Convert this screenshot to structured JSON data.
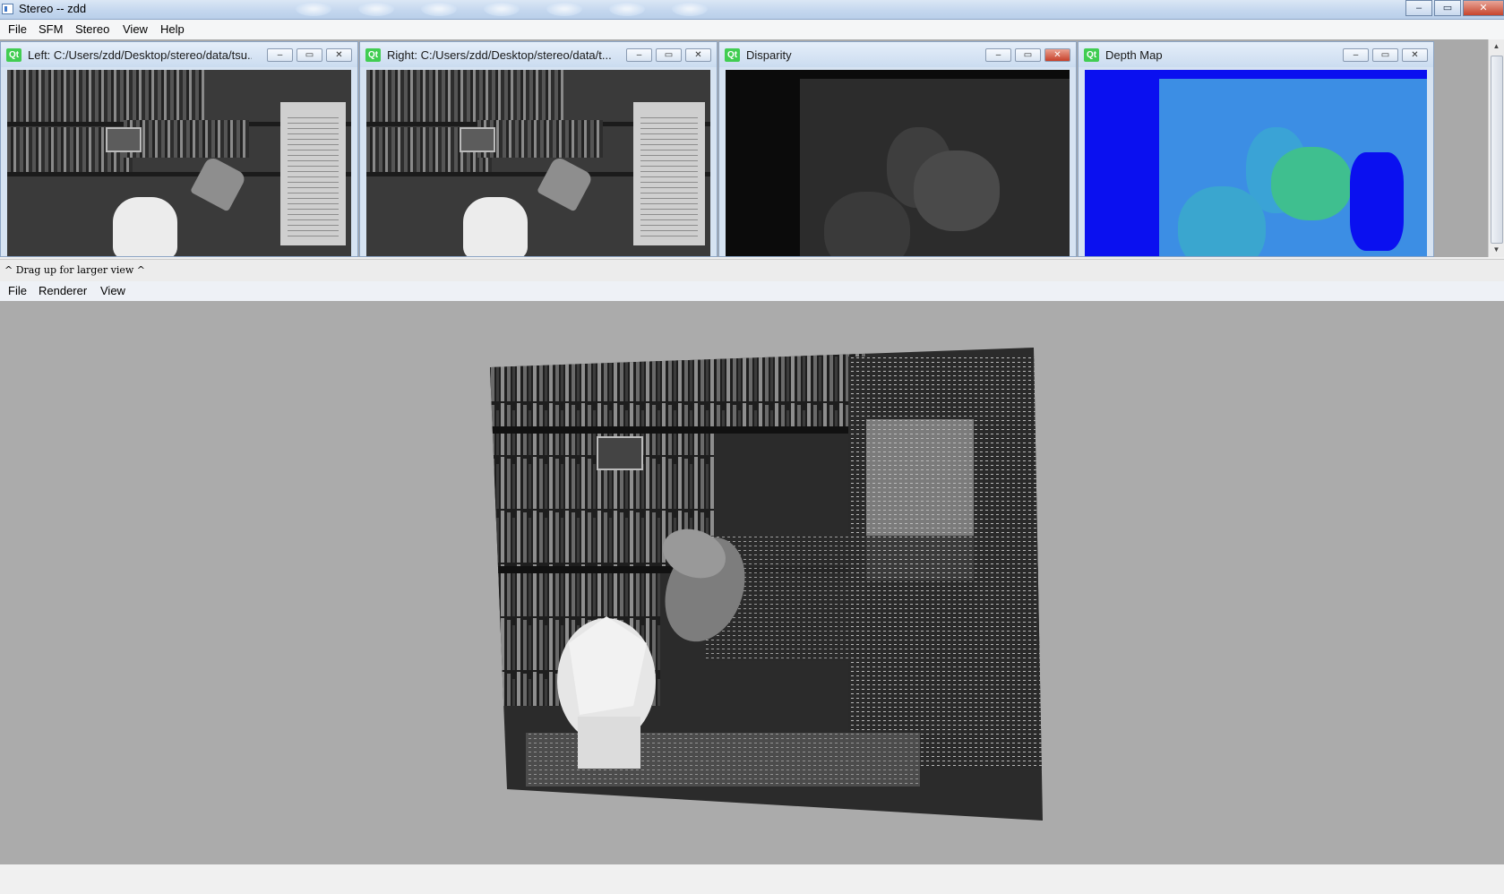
{
  "window": {
    "title": "Stereo -- zdd",
    "controls": {
      "minimize": "–",
      "maximize": "▭",
      "close": "✕"
    }
  },
  "menubar_top": {
    "items": [
      "File",
      "SFM",
      "Stereo",
      "View",
      "Help"
    ]
  },
  "subwindows": [
    {
      "title": "Left: C:/Users/zdd/Desktop/stereo/data/tsu...",
      "logo": "Qt",
      "btns": [
        "–",
        "▭",
        "✕"
      ]
    },
    {
      "title": "Right: C:/Users/zdd/Desktop/stereo/data/t...",
      "logo": "Qt",
      "btns": [
        "–",
        "▭",
        "✕"
      ]
    },
    {
      "title": "Disparity",
      "logo": "Qt",
      "btns": [
        "–",
        "▭",
        "✕"
      ]
    },
    {
      "title": "Depth Map",
      "logo": "Qt",
      "btns": [
        "–",
        "▭",
        "✕"
      ]
    }
  ],
  "splitter": {
    "hint": "^ Drag up for larger view ^"
  },
  "menubar_bottom": {
    "items": [
      "File",
      "Renderer",
      "View"
    ]
  },
  "colors": {
    "viewport_bg": "#ababab",
    "depth_far": "#0a10f0",
    "depth_mid": "#3c8ee4",
    "depth_near": "#3fbf8f"
  }
}
